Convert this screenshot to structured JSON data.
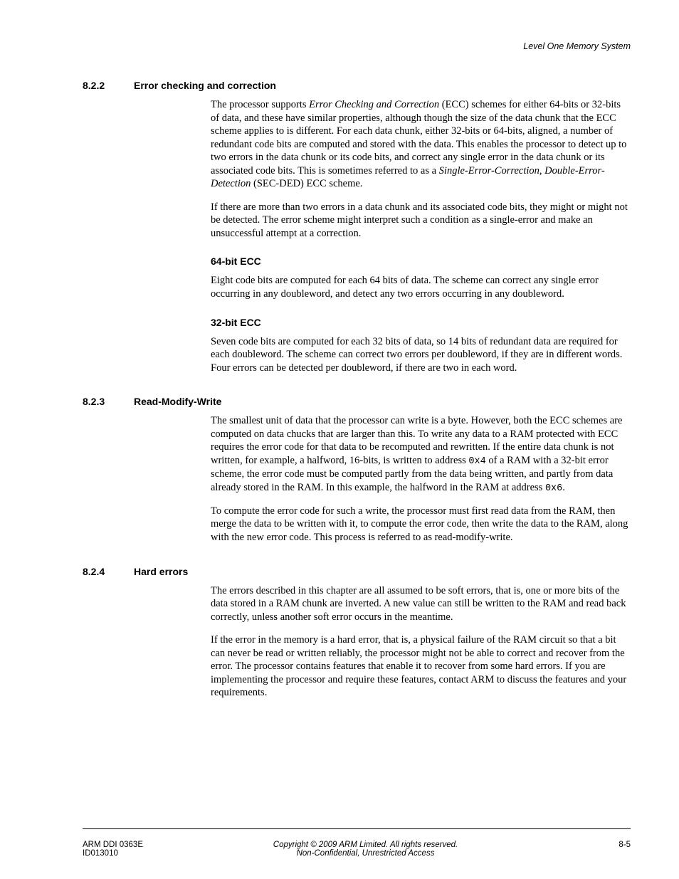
{
  "running_head": "Level One Memory System",
  "sections": {
    "s822": {
      "num": "8.2.2",
      "title": "Error checking and correction",
      "p1a": "The processor supports ",
      "p1b": "Error Checking and Correction",
      "p1c": " (ECC) schemes for either 64-bits or 32-bits of data, and these have similar properties, although though the size of the data chunk that the ECC scheme applies to is different. For each data chunk, either 32-bits or 64-bits, aligned, a number of redundant code bits are computed and stored with the data. This enables the processor to detect up to two errors in the data chunk or its code bits, and correct any single error in the data chunk or its associated code bits. This is sometimes referred to as a ",
      "p1d": "Single-Error-Correction, Double-Error-Detection",
      "p1e": " (SEC-DED) ECC scheme.",
      "p2": "If there are more than two errors in a data chunk and its associated code bits, they might or might not be detected. The error scheme might interpret such a condition as a single-error and make an unsuccessful attempt at a correction.",
      "sub64": {
        "title": "64-bit ECC",
        "p1": "Eight code bits are computed for each 64 bits of data. The scheme can correct any single error occurring in any doubleword, and detect any two errors occurring in any doubleword."
      },
      "sub32": {
        "title": "32-bit ECC",
        "p1": "Seven code bits are computed for each 32 bits of data, so 14 bits of redundant data are required for each doubleword. The scheme can correct two errors per doubleword, if they are in different words. Four errors can be detected per doubleword, if there are two in each word."
      }
    },
    "s823": {
      "num": "8.2.3",
      "title": "Read-Modify-Write",
      "p1a": "The smallest unit of data that the processor can write is a byte. However, both the ECC schemes are computed on data chucks that are larger than this. To write any data to a RAM protected with ECC requires the error code for that data to be recomputed and rewritten. If the entire data chunk is not written, for example, a halfword, 16-bits, is written to address ",
      "p1b": "0x4",
      "p1c": " of a RAM with a 32-bit error scheme, the error code must be computed partly from the data being written, and partly from data already stored in the RAM. In this example, the halfword in the RAM at address ",
      "p1d": "0x6",
      "p1e": ".",
      "p2": "To compute the error code for such a write, the processor must first read data from the RAM, then merge the data to be written with it, to compute the error code, then write the data to the RAM, along with the new error code. This process is referred to as read-modify-write."
    },
    "s824": {
      "num": "8.2.4",
      "title": "Hard errors",
      "p1": "The errors described in this chapter are all assumed to be soft errors, that is, one or more bits of the data stored in a RAM chunk are inverted. A new value can still be written to the RAM and read back correctly, unless another soft error occurs in the meantime.",
      "p2": "If the error in the memory is a hard error, that is, a physical failure of the RAM circuit so that a bit can never be read or written reliably, the processor might not be able to correct and recover from the error. The processor contains features that enable it to recover from some hard errors. If you are implementing the processor and require these features, contact ARM to discuss the features and your requirements."
    }
  },
  "footer": {
    "left1": "ARM DDI 0363E",
    "left2": "ID013010",
    "center1": "Copyright © 2009 ARM Limited. All rights reserved.",
    "center2": "Non-Confidential, Unrestricted Access",
    "right": "8-5"
  }
}
